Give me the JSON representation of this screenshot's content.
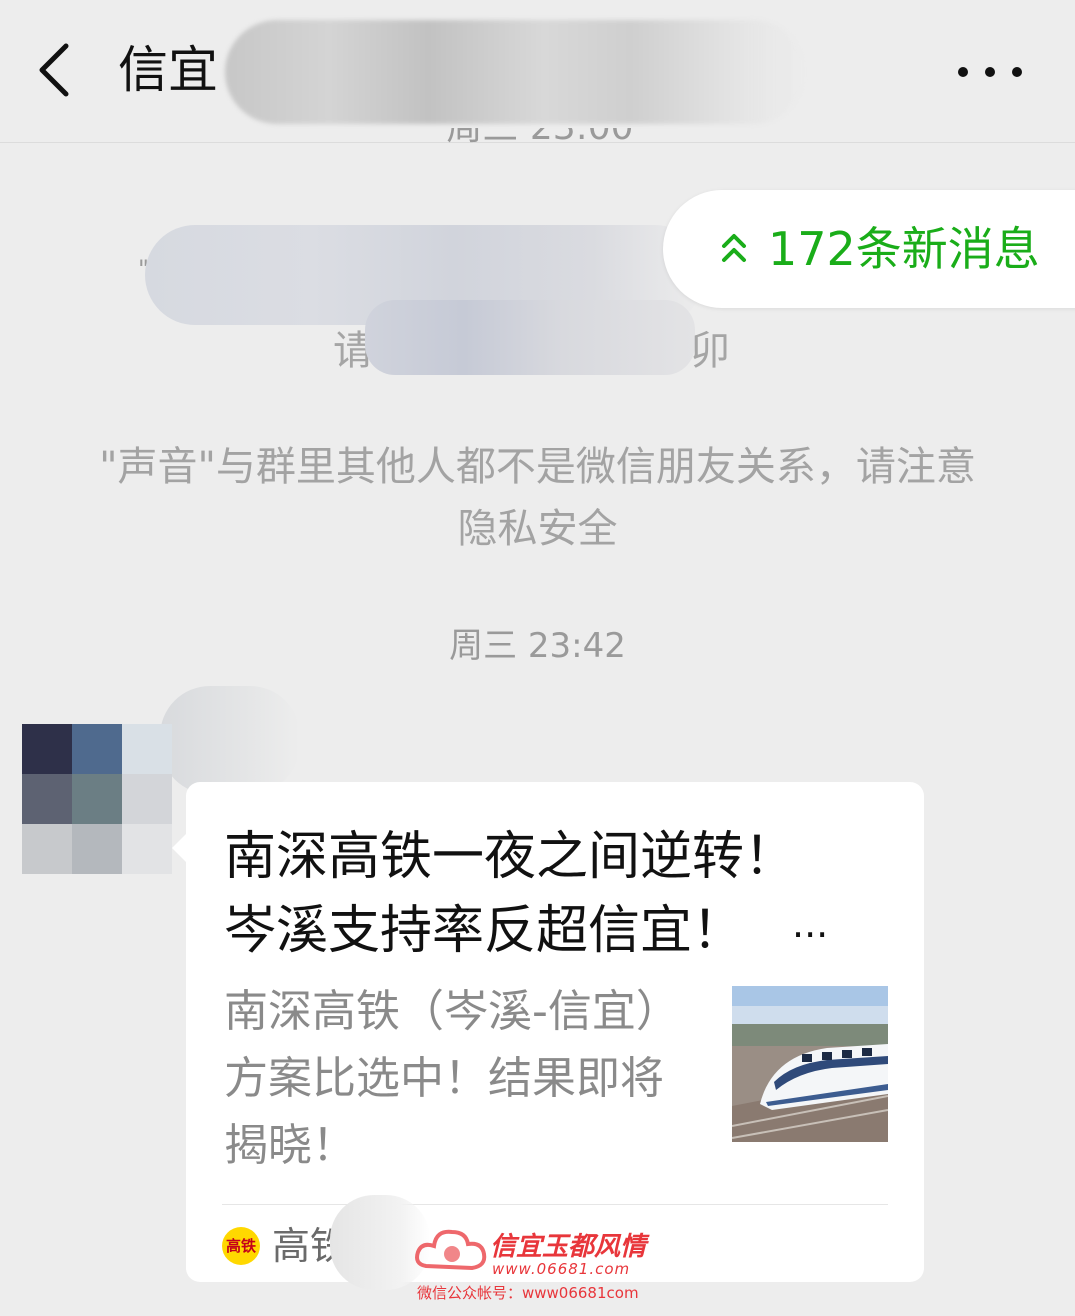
{
  "header": {
    "title_visible": "信宜",
    "more_glyph": "•••"
  },
  "history": {
    "partial_timestamp": "周三 23:00"
  },
  "new_messages": {
    "label": "172条新消息",
    "color": "#1aad19"
  },
  "notices": {
    "redacted_quote": "\"",
    "redacted_fragment_a": "请",
    "redacted_fragment_b": "卯",
    "privacy": "\"声音\"与群里其他人都不是微信朋友关系，请注意隐私安全"
  },
  "timestamp": "周三 23:42",
  "shared_article": {
    "title": "南深高铁一夜之间逆转！岑溪支持率反超信宜！",
    "more_indicator": "...",
    "description": "南深高铁（岑溪-信宜）方案比选中！结果即将揭晓！",
    "thumbnail": "high-speed-train-photo",
    "source_icon_text": "高铁",
    "source_name": "高铁"
  },
  "watermark": {
    "brand": "信宜玉都风情",
    "url": "www.06681.com",
    "account": "微信公众帐号：www06681com"
  }
}
